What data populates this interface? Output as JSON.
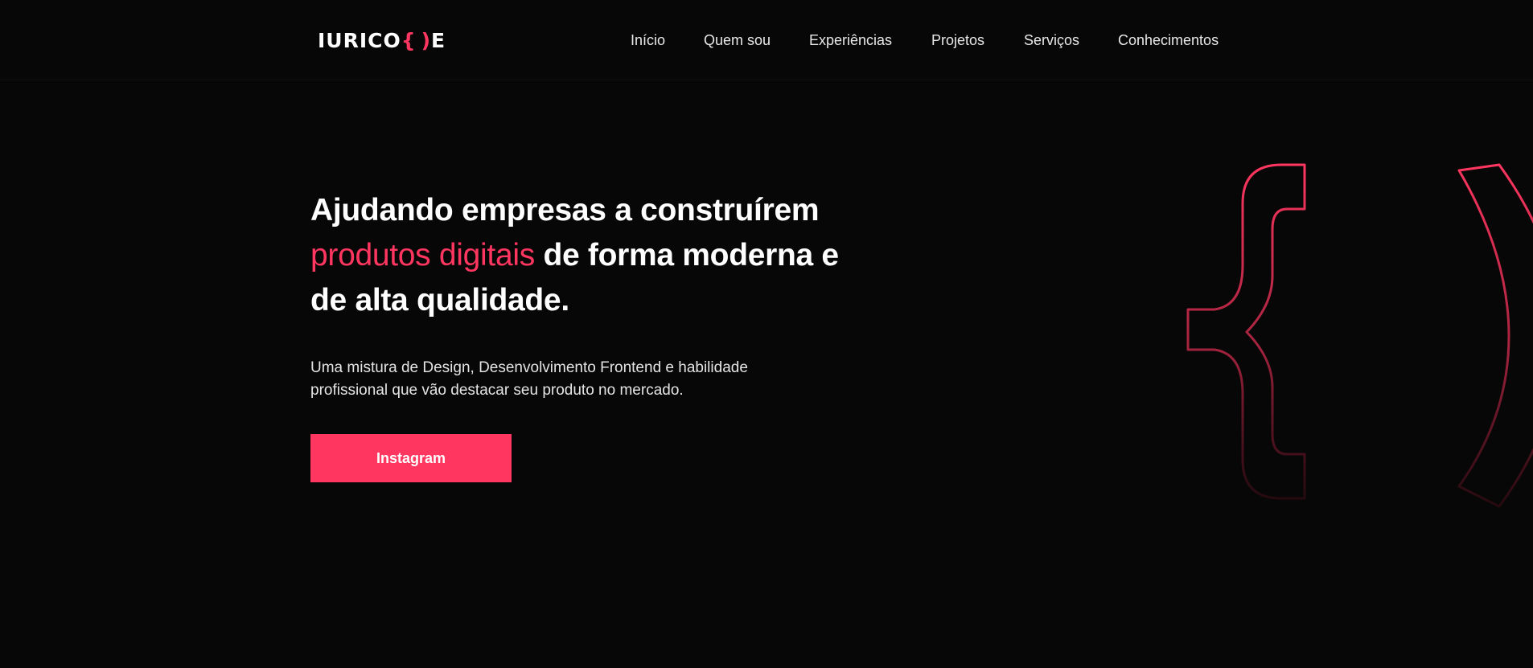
{
  "header": {
    "logo": {
      "prefix": "IURICO",
      "brace_open": "{",
      "paren_close": ")",
      "suffix": "E"
    },
    "nav": [
      {
        "label": "Início"
      },
      {
        "label": "Quem sou"
      },
      {
        "label": "Experiências"
      },
      {
        "label": "Projetos"
      },
      {
        "label": "Serviços"
      },
      {
        "label": "Conhecimentos"
      }
    ]
  },
  "hero": {
    "title_part1": "Ajudando empresas a construírem",
    "title_highlight": "produtos digitais",
    "title_part2": " de forma moderna e de alta qualidade.",
    "subtitle": "Uma mistura de Design, Desenvolvimento Frontend e habilidade profissional que vão destacar seu produto no mercado.",
    "cta_label": "Instagram"
  },
  "decoration": {
    "icon": "curly-brace-paren-outline-icon",
    "color": "#ff3660"
  },
  "colors": {
    "background": "#070707",
    "accent": "#ff3660",
    "text": "#ffffff"
  }
}
